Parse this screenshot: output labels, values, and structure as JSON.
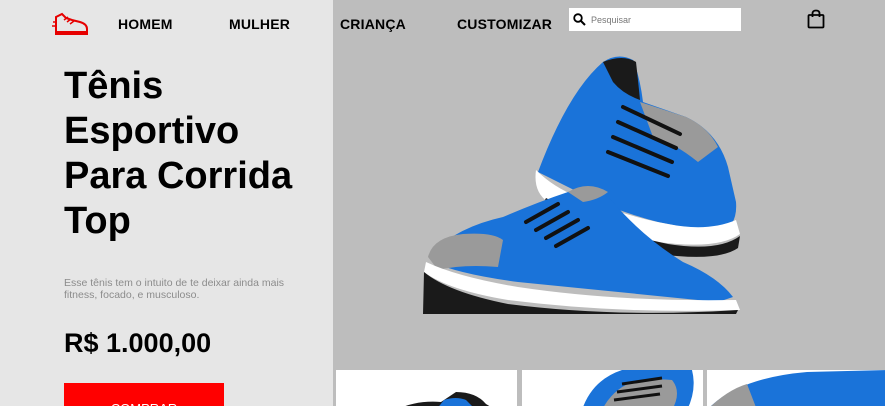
{
  "nav": {
    "links": [
      "HOMEM",
      "MULHER",
      "CRIANÇA",
      "CUSTOMIZAR"
    ]
  },
  "search": {
    "placeholder": "Pesquisar"
  },
  "product": {
    "title_lines": [
      "Tênis",
      "Esportivo",
      "Para Corrida",
      "Top"
    ],
    "description": "Esse tênis tem o intuito de te deixar ainda mais fitness, focado, e musculoso.",
    "price": "R$ 1.000,00",
    "buy_label": "COMPRAR"
  },
  "icons": {
    "logo": "running-shoe-icon",
    "search": "search-icon",
    "cart": "shopping-bag-icon"
  },
  "colors": {
    "accent": "#ff0000",
    "left_bg": "#e6e6e6",
    "right_bg": "#bdbdbd",
    "shoe_blue": "#1a73d9"
  }
}
